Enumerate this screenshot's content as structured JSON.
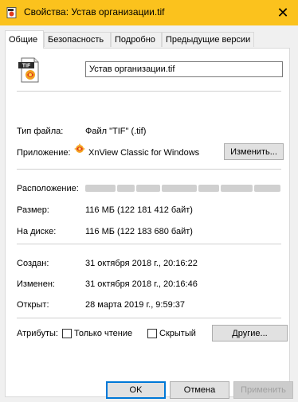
{
  "window": {
    "title": "Свойства: Устав организации.tif",
    "close_glyph": "✕"
  },
  "tabs": [
    {
      "label": "Общие",
      "active": true
    },
    {
      "label": "Безопасность",
      "active": false
    },
    {
      "label": "Подробно",
      "active": false
    },
    {
      "label": "Предыдущие версии",
      "active": false
    }
  ],
  "file": {
    "name": "Устав организации.tif",
    "icon": "tif-image-file-icon",
    "icon_badge": "TIF"
  },
  "type": {
    "label": "Тип файла:",
    "value": "Файл \"TIF\" (.tif)"
  },
  "app": {
    "label": "Приложение:",
    "value": "XnView Classic for Windows",
    "icon": "xnview-app-icon",
    "change_button": "Изменить..."
  },
  "location": {
    "label": "Расположение:"
  },
  "size": {
    "label": "Размер:",
    "value": "116 МБ (122 181 412 байт)"
  },
  "disk": {
    "label": "На диске:",
    "value": "116 МБ (122 183 680 байт)"
  },
  "created": {
    "label": "Создан:",
    "value": "31 октября 2018 г., 20:16:22"
  },
  "modified": {
    "label": "Изменен:",
    "value": "31 октября 2018 г., 20:16:46"
  },
  "accessed": {
    "label": "Открыт:",
    "value": "28 марта 2019 г., 9:59:37"
  },
  "attributes": {
    "label": "Атрибуты:",
    "readonly_label": "Только чтение",
    "readonly_checked": false,
    "hidden_label": "Скрытый",
    "hidden_checked": false,
    "other_button": "Другие..."
  },
  "footer": {
    "ok": "OK",
    "cancel": "Отмена",
    "apply": "Применить"
  },
  "colors": {
    "titlebar": "#fbc21d",
    "default_button_border": "#0078d7"
  }
}
